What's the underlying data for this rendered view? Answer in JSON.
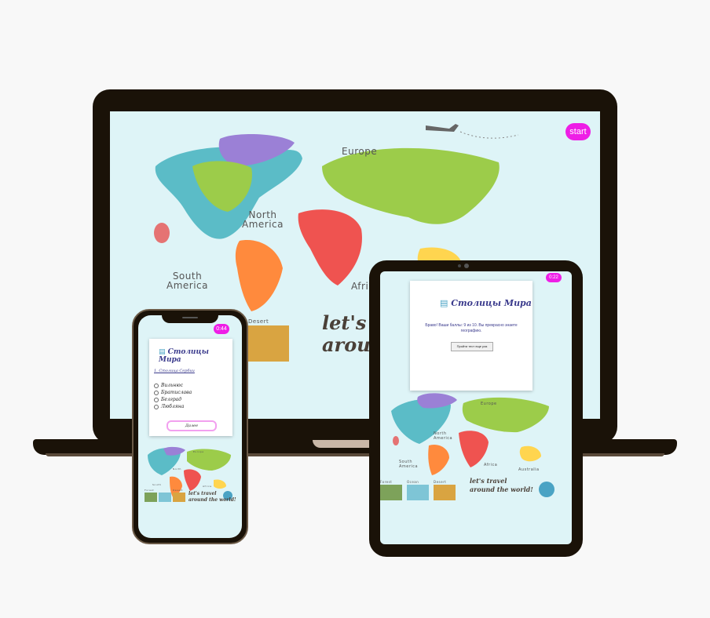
{
  "laptop": {
    "start_button": "start",
    "labels": {
      "europe": "Europe",
      "north_america": "North\nAmerica",
      "south_america": "South\nAmerica",
      "africa": "Afri",
      "desert": "Desert"
    },
    "slogan_line1": "let's travel",
    "slogan_line2": "around the world!"
  },
  "phone": {
    "timer": "0:44",
    "app_title": "Столицы Мира",
    "question": "1. Столица Сербии",
    "options": [
      "Вильнюс",
      "Братислава",
      "Белград",
      "Любляна"
    ],
    "next_button": "Далее",
    "slogan_line1": "let's travel",
    "slogan_line2": "around the world!",
    "labels": {
      "europe": "Europe",
      "north_america": "North",
      "south_america": "South",
      "africa": "Africa",
      "forest": "Forest",
      "desert": "Desert"
    }
  },
  "tablet": {
    "timer": "0:22",
    "app_title": "Столицы Мира",
    "result_text": "Браво! Ваши баллы: 9 из 10. Вы прекрасно знаете географию.",
    "retry_button": "Пройти тест еще раз",
    "labels": {
      "europe": "Europe",
      "north_america": "North\nAmerica",
      "south_america": "South\nAmerica",
      "africa": "Africa",
      "australia": "Australia",
      "forest": "Forest",
      "ocean": "Ocean",
      "desert": "Desert"
    },
    "slogan_line1": "let's travel",
    "slogan_line2": "around the world!"
  },
  "colors": {
    "accent": "#ee1ee6",
    "device_frame": "#1a1208",
    "map_bg": "#def4f7",
    "title": "#3a3a8c"
  }
}
